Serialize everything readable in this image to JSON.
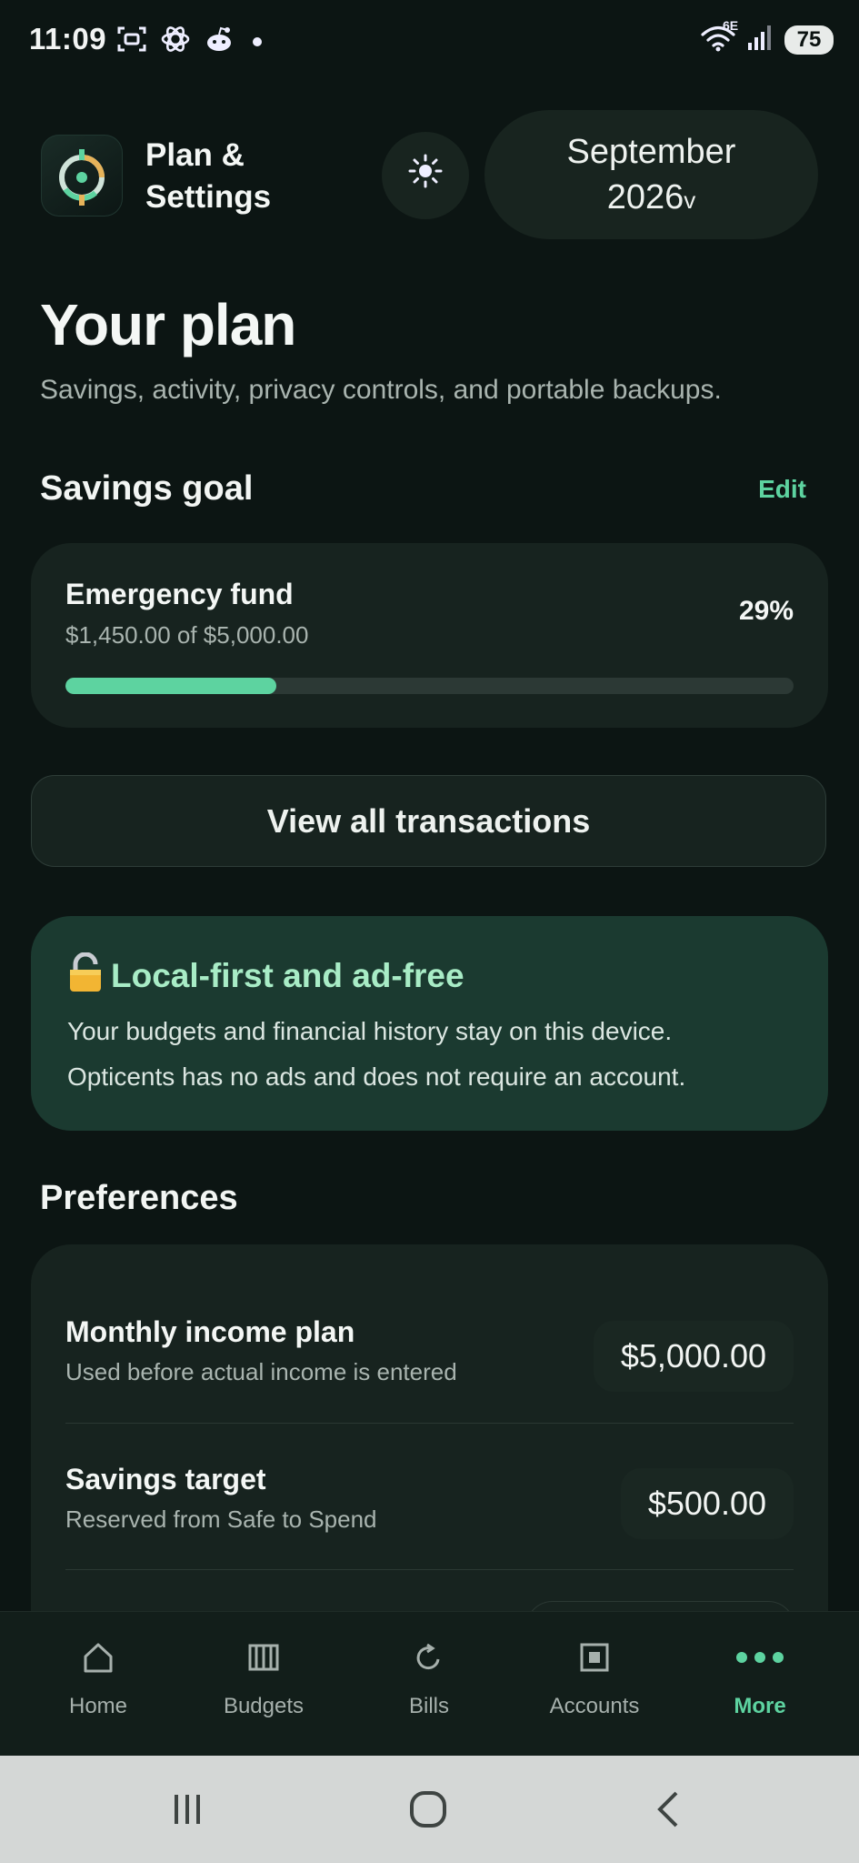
{
  "status_bar": {
    "time": "11:09",
    "network": "6E",
    "battery": "75"
  },
  "header": {
    "title": "Plan & Settings",
    "month": "September",
    "year": "2026",
    "month_chevron": "v",
    "icons": {
      "logo": "target-icon",
      "theme": "sun-icon"
    }
  },
  "page": {
    "title": "Your plan",
    "subtitle": "Savings, activity, privacy controls, and portable backups."
  },
  "savings": {
    "heading": "Savings goal",
    "edit_label": "Edit",
    "goal_name": "Emergency fund",
    "goal_amount": "$1,450.00 of $5,000.00",
    "percent_label": "29%",
    "progress": 0.29,
    "accent_color": "#5dd3a0"
  },
  "transactions_button": "View all transactions",
  "privacy": {
    "icon": "lock-icon",
    "title": "Local-first and ad-free",
    "line1": "Your budgets and financial history stay on this device.",
    "line2": "Opticents has no ads and does not require an account."
  },
  "preferences": {
    "heading": "Preferences",
    "items": [
      {
        "label": "Monthly income plan",
        "desc": "Used before actual income is entered",
        "value": "$5,000.00"
      },
      {
        "label": "Savings target",
        "desc": "Reserved from Safe to Spend",
        "value": "$500.00"
      }
    ]
  },
  "nav": {
    "items": [
      {
        "label": "Home",
        "icon": "home-icon"
      },
      {
        "label": "Budgets",
        "icon": "budgets-icon"
      },
      {
        "label": "Bills",
        "icon": "refresh-icon"
      },
      {
        "label": "Accounts",
        "icon": "accounts-icon"
      },
      {
        "label": "More",
        "icon": "more-dots-icon"
      }
    ],
    "active": "More"
  },
  "colors": {
    "background": "#0c1513",
    "card": "#17231f",
    "privacy_card": "#1b3a30",
    "accent": "#5dd3a0"
  }
}
